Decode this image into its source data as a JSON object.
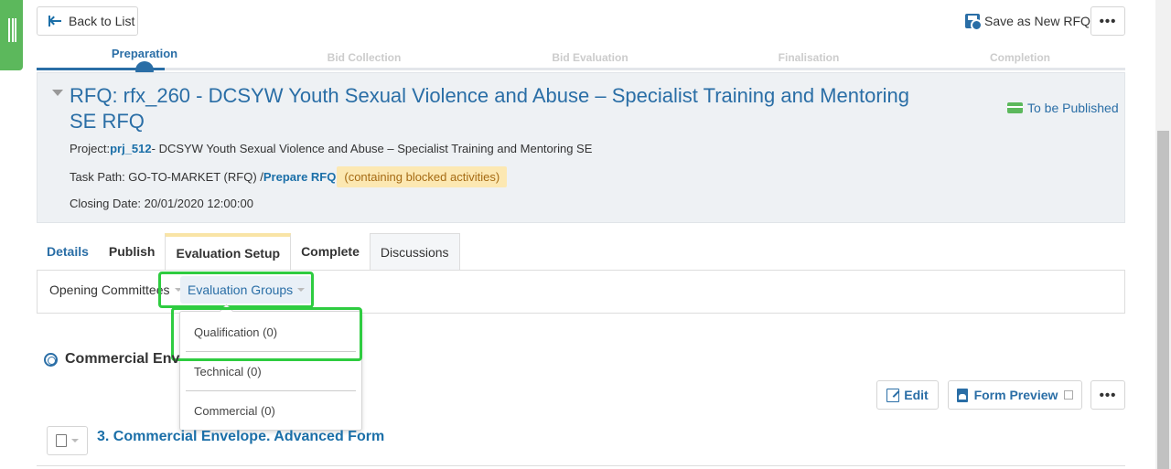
{
  "topbar": {
    "back_label": "Back to List",
    "save_new_label": "Save as New RFQ",
    "more_label": "•••"
  },
  "steps": [
    {
      "label": "Preparation",
      "state": "active"
    },
    {
      "label": "Bid Collection",
      "state": "future"
    },
    {
      "label": "Bid Evaluation",
      "state": "future"
    },
    {
      "label": "Finalisation",
      "state": "future"
    },
    {
      "label": "Completion",
      "state": "future"
    }
  ],
  "header": {
    "title": "RFQ: rfx_260 - DCSYW Youth Sexual Violence and Abuse – Specialist Training and Mentoring SE RFQ",
    "status": "To be Published",
    "project_label": "Project:",
    "project_code": "prj_512",
    "project_name": "- DCSYW Youth Sexual Violence and Abuse – Specialist Training and Mentoring SE",
    "task_path_label": "Task Path: GO-TO-MARKET (RFQ) /",
    "task_path_link": "Prepare RFQ",
    "blocked_note": "(containing blocked activities)",
    "closing_date": "Closing Date: 20/01/2020 12:00:00"
  },
  "tabs": [
    {
      "label": "Details"
    },
    {
      "label": "Publish"
    },
    {
      "label": "Evaluation Setup",
      "active": true
    },
    {
      "label": "Complete"
    },
    {
      "label": "Discussions"
    }
  ],
  "subnav": {
    "opening": "Opening Committees",
    "evaluation": "Evaluation Groups"
  },
  "dropdown": {
    "items": [
      "Qualification (0)",
      "Technical (0)",
      "Commercial (0)"
    ]
  },
  "section": {
    "title": "Commercial Env",
    "edit_label": "Edit",
    "preview_label": "Form Preview",
    "more_label": "•••",
    "form_title": "3. Commercial Envelope. Advanced Form"
  },
  "colors": {
    "accent": "#2a6ea6",
    "highlight": "#2ecc40",
    "handle": "#5cb85c",
    "blocked_bg": "#fce8b2"
  }
}
